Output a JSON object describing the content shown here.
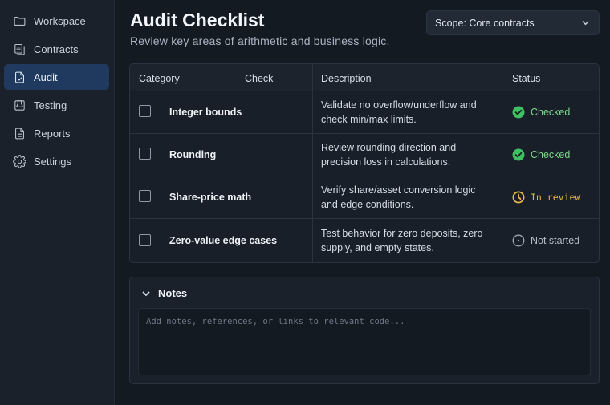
{
  "sidebar": {
    "items": [
      {
        "label": "Workspace",
        "icon": "folder-icon",
        "active": false
      },
      {
        "label": "Contracts",
        "icon": "contracts-icon",
        "active": false
      },
      {
        "label": "Audit",
        "icon": "audit-document-icon",
        "active": true
      },
      {
        "label": "Testing",
        "icon": "testing-beaker-icon",
        "active": false
      },
      {
        "label": "Reports",
        "icon": "report-document-icon",
        "active": false
      },
      {
        "label": "Settings",
        "icon": "gear-icon",
        "active": false
      }
    ]
  },
  "header": {
    "title": "Audit Checklist",
    "subtitle": "Review key areas of arithmetic and business logic.",
    "scope_label": "Scope: Core contracts"
  },
  "table": {
    "columns": {
      "category": "Category",
      "check": "Check",
      "description": "Description",
      "status": "Status"
    },
    "rows": [
      {
        "category": "Integer bounds",
        "description": "Validate no overflow/underflow and check min/max limits.",
        "status": "Checked",
        "status_kind": "checked",
        "checked": false
      },
      {
        "category": "Rounding",
        "description": "Review rounding direction and precision loss in calculations.",
        "status": "Checked",
        "status_kind": "checked",
        "checked": false
      },
      {
        "category": "Share-price math",
        "description": "Verify share/asset conversion logic and edge conditions.",
        "status": "In review",
        "status_kind": "review",
        "checked": false
      },
      {
        "category": "Zero-value edge cases",
        "description": "Test behavior for zero deposits, zero supply, and empty states.",
        "status": "Not started",
        "status_kind": "notstarted",
        "checked": false
      }
    ]
  },
  "notes": {
    "label": "Notes",
    "placeholder": "Add notes, references, or links to relevant code...",
    "value": ""
  },
  "colors": {
    "accent_active": "#1f3a5e",
    "checked": "#7fd68e",
    "review": "#e4b648",
    "not_started": "#b3bcc8"
  }
}
